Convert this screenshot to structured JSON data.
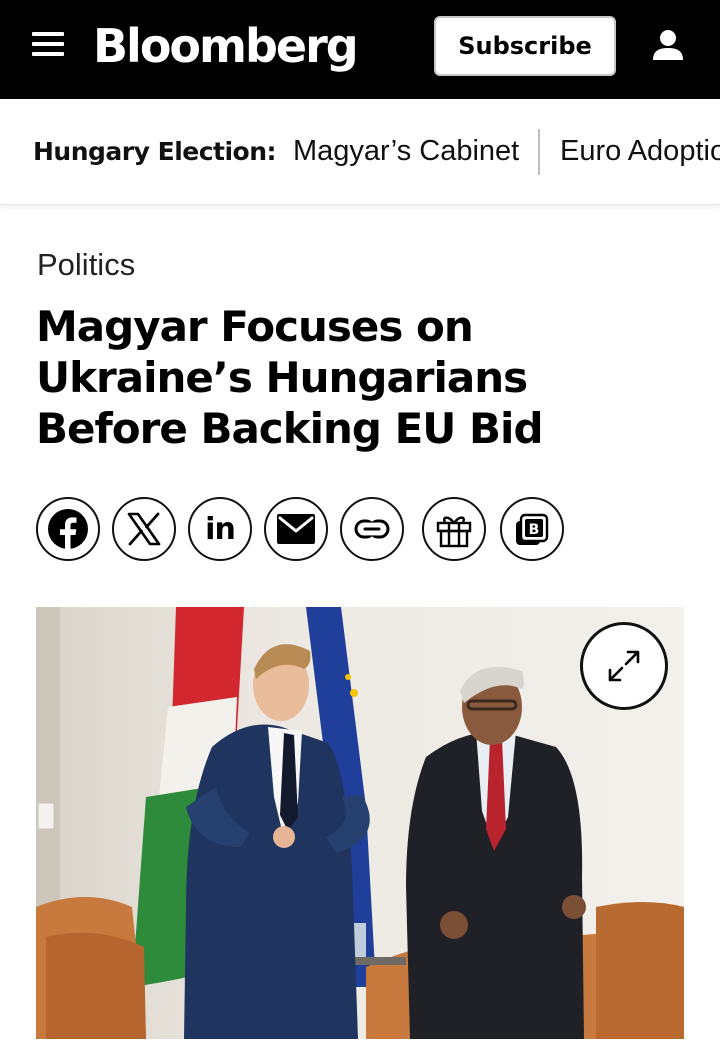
{
  "header": {
    "logo_text": "Bloomberg",
    "subscribe_label": "Subscribe",
    "menu_icon": "hamburger-menu-icon",
    "account_icon": "user-icon"
  },
  "topics": {
    "label": "Hungary Election:",
    "items": [
      "Magyar’s Cabinet",
      "Euro Adoption"
    ]
  },
  "article": {
    "kicker": "Politics",
    "headline_lines": [
      "Magyar Focuses on",
      "Ukraine’s Hungarians",
      "Before Backing EU Bid"
    ]
  },
  "share": {
    "buttons": [
      {
        "icon": "facebook-icon"
      },
      {
        "icon": "x-icon"
      },
      {
        "icon": "linkedin-icon",
        "text": "in"
      },
      {
        "icon": "email-icon"
      },
      {
        "icon": "link-icon"
      },
      {
        "icon": "gift-icon"
      },
      {
        "icon": "bloomberg-b-icon",
        "text": "B"
      }
    ]
  },
  "photo": {
    "expand_icon": "expand-icon"
  },
  "colors": {
    "topbar_bg": "#000000",
    "flag_red": "#d3272f",
    "flag_green": "#2e8b3c",
    "eu_blue": "#1f3f9a",
    "sofa": "#c87a3e"
  }
}
